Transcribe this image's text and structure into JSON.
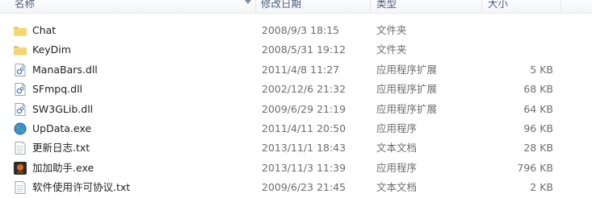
{
  "columns": {
    "name": "名称",
    "date": "修改日期",
    "type": "类型",
    "size": "大小"
  },
  "files": [
    {
      "name": "Chat",
      "date": "2008/9/3 18:15",
      "type": "文件夹",
      "size": "",
      "icon": "folder-icon"
    },
    {
      "name": "KeyDim",
      "date": "2008/5/31 19:12",
      "type": "文件夹",
      "size": "",
      "icon": "folder-icon"
    },
    {
      "name": "ManaBars.dll",
      "date": "2011/4/8 11:27",
      "type": "应用程序扩展",
      "size": "5 KB",
      "icon": "dll-icon"
    },
    {
      "name": "SFmpq.dll",
      "date": "2002/12/6 21:32",
      "type": "应用程序扩展",
      "size": "68 KB",
      "icon": "dll-icon"
    },
    {
      "name": "SW3GLib.dll",
      "date": "2009/6/29 21:19",
      "type": "应用程序扩展",
      "size": "64 KB",
      "icon": "dll-icon"
    },
    {
      "name": "UpData.exe",
      "date": "2011/4/11 20:50",
      "type": "应用程序",
      "size": "96 KB",
      "icon": "globe-exe-icon"
    },
    {
      "name": "更新日志.txt",
      "date": "2013/11/1 18:43",
      "type": "文本文档",
      "size": "28 KB",
      "icon": "text-file-icon"
    },
    {
      "name": "加加助手.exe",
      "date": "2013/11/3 11:39",
      "type": "应用程序",
      "size": "796 KB",
      "icon": "app-exe-icon"
    },
    {
      "name": "软件使用许可协议.txt",
      "date": "2009/6/23 21:45",
      "type": "文本文档",
      "size": "2 KB",
      "icon": "text-file-icon"
    }
  ]
}
